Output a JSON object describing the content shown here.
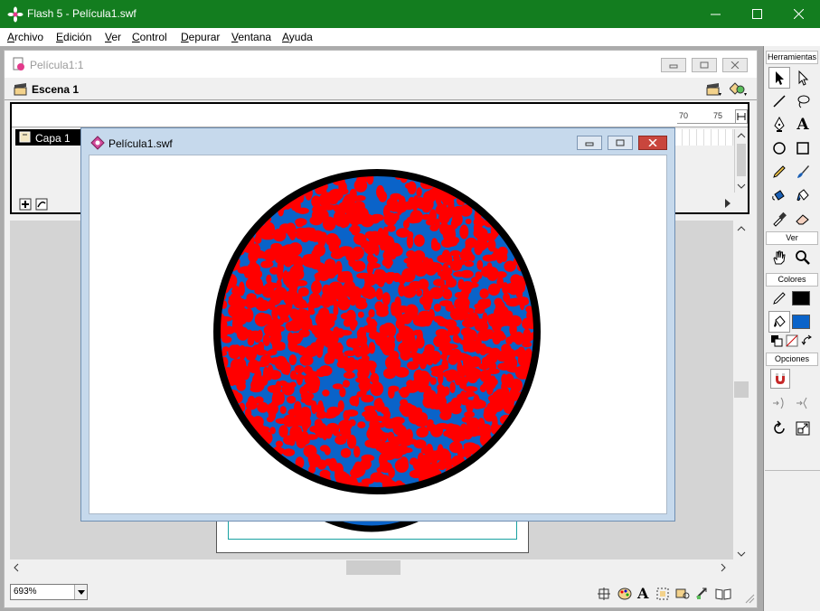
{
  "app": {
    "title": "Flash 5 - Película1.swf",
    "caption_buttons": [
      "minimize",
      "maximize",
      "close"
    ]
  },
  "menubar": {
    "items": [
      {
        "label": "Archivo"
      },
      {
        "label": "Edición"
      },
      {
        "label": "Ver"
      },
      {
        "label": "Control"
      },
      {
        "label": "Depurar"
      },
      {
        "label": "Ventana"
      },
      {
        "label": "Ayuda"
      }
    ]
  },
  "movie_window": {
    "title": "Película1:1",
    "scene_label": "Escena 1",
    "layer_name": "Capa 1",
    "timeline_ruler": [
      "70",
      "75"
    ],
    "zoom_value": "693%"
  },
  "swf_window": {
    "title": "Película1.swf"
  },
  "tools_panel": {
    "title": "Herramientas",
    "section_view": "Ver",
    "section_colors": "Colores",
    "section_options": "Opciones",
    "colors": {
      "stroke": "#000000",
      "fill": "#0a63c9",
      "art_red": "#ff0000",
      "art_outline": "#000000"
    }
  }
}
